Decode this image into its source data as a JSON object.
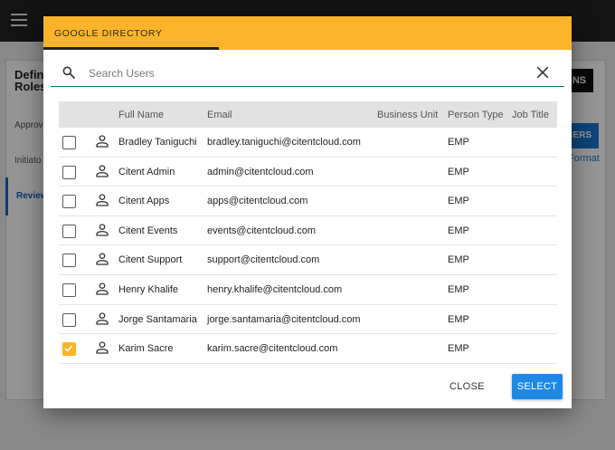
{
  "background": {
    "page_title_line1": "Defin",
    "page_title_line2": "Roles",
    "tabs": [
      {
        "label": "Approv"
      },
      {
        "label": "Initiato"
      },
      {
        "label": "Review"
      }
    ],
    "button_dark_label": "NS",
    "button_blue_label": "BERS",
    "format_link": "Format"
  },
  "dialog": {
    "title": "GOOGLE DIRECTORY",
    "search": {
      "placeholder": "Search Users",
      "value": ""
    },
    "columns": [
      "Full Name",
      "Email",
      "Business Unit",
      "Person Type",
      "Job Title"
    ],
    "rows": [
      {
        "checked": false,
        "name": "Bradley Taniguchi",
        "email": "bradley.taniguchi@citentcloud.com",
        "business_unit": "",
        "person_type": "EMP",
        "job_title": ""
      },
      {
        "checked": false,
        "name": "Citent Admin",
        "email": "admin@citentcloud.com",
        "business_unit": "",
        "person_type": "EMP",
        "job_title": ""
      },
      {
        "checked": false,
        "name": "Citent Apps",
        "email": "apps@citentcloud.com",
        "business_unit": "",
        "person_type": "EMP",
        "job_title": ""
      },
      {
        "checked": false,
        "name": "Citent Events",
        "email": "events@citentcloud.com",
        "business_unit": "",
        "person_type": "EMP",
        "job_title": ""
      },
      {
        "checked": false,
        "name": "Citent Support",
        "email": "support@citentcloud.com",
        "business_unit": "",
        "person_type": "EMP",
        "job_title": ""
      },
      {
        "checked": false,
        "name": "Henry Khalife",
        "email": "henry.khalife@citentcloud.com",
        "business_unit": "",
        "person_type": "EMP",
        "job_title": ""
      },
      {
        "checked": false,
        "name": "Jorge Santamaria",
        "email": "jorge.santamaria@citentcloud.com",
        "business_unit": "",
        "person_type": "EMP",
        "job_title": ""
      },
      {
        "checked": true,
        "name": "Karim Sacre",
        "email": "karim.sacre@citentcloud.com",
        "business_unit": "",
        "person_type": "EMP",
        "job_title": ""
      }
    ],
    "close_label": "CLOSE",
    "select_label": "SELECT"
  },
  "colors": {
    "header_accent": "#fbb429",
    "primary_button": "#1e88e5",
    "search_underline": "#00796b"
  },
  "icons": {
    "menu": "hamburger-icon",
    "search": "search-icon",
    "close": "close-icon",
    "person": "person-icon",
    "checkbox": "checkbox-icon"
  }
}
